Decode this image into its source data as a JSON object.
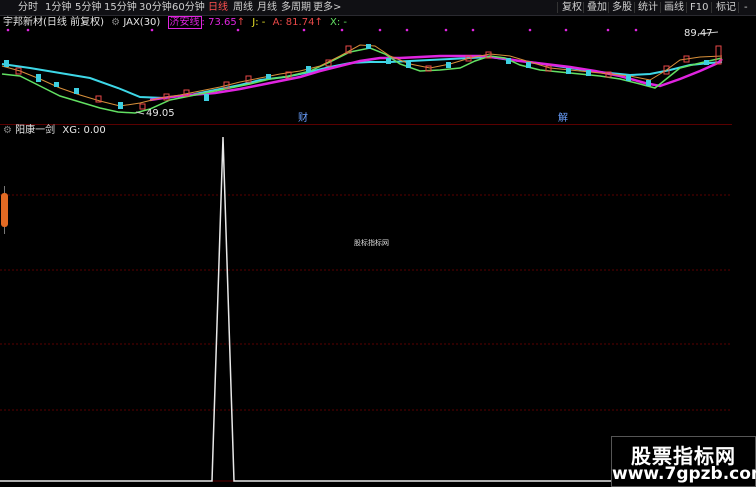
{
  "toolbar": {
    "left_tabs": [
      "分时",
      "1分钟",
      "5分钟",
      "15分钟",
      "30分钟",
      "60分钟",
      "日线",
      "周线",
      "月线",
      "多周期",
      "更多>"
    ],
    "active_tab": "日线",
    "right_buttons": [
      "复权",
      "叠加",
      "多股",
      "统计",
      "画线",
      "F10",
      "标记",
      "-"
    ]
  },
  "main_panel": {
    "stock_title": "宇邦新材(日线 前复权)",
    "indicator": "JAX(30)",
    "line1_name": "济安线",
    "line1_value": "73.65",
    "j_label": "J: -",
    "a_label": "A: 81.74",
    "x_label": "X: -",
    "high_price": "89.47",
    "low_price": "49.05",
    "marker_1": "财",
    "marker_2": "解",
    "colors": {
      "jax_line": "#e024e0",
      "cyan_line": "#3ed8e8",
      "green_line": "#62e062",
      "orange_line": "#d8903a",
      "rise": "#e84848",
      "fall": "#3ecfe0",
      "high_text": "#e6e6e6"
    }
  },
  "sub_panel": {
    "indicator": "阳康一剑",
    "xg_label": "XG: 0.00",
    "signal_value": 1
  },
  "watermark": "股标指标网",
  "brand": {
    "line1": "股票指标网",
    "line2": "www.7gpzb.com"
  }
}
